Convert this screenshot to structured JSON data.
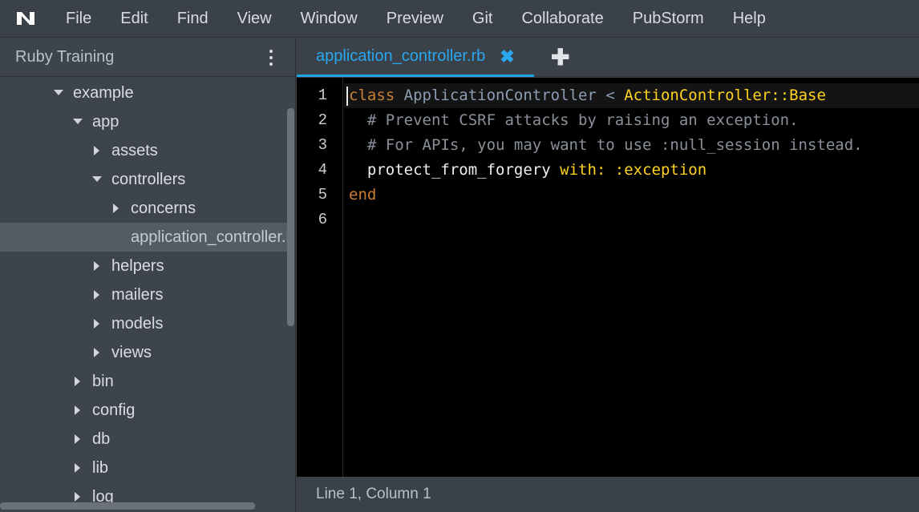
{
  "menu": {
    "logo_icon": "nitrous-n-icon",
    "items": [
      "File",
      "Edit",
      "Find",
      "View",
      "Window",
      "Preview",
      "Git",
      "Collaborate",
      "PubStorm",
      "Help"
    ]
  },
  "sidebar": {
    "project_title": "Ruby Training",
    "tree": [
      {
        "label": "example",
        "expanded": true
      },
      {
        "label": "app",
        "expanded": true
      },
      {
        "label": "assets",
        "expanded": false
      },
      {
        "label": "controllers",
        "expanded": true
      },
      {
        "label": "concerns",
        "expanded": false
      },
      {
        "label": "application_controller.rb",
        "selected": true
      },
      {
        "label": "helpers",
        "expanded": false
      },
      {
        "label": "mailers",
        "expanded": false
      },
      {
        "label": "models",
        "expanded": false
      },
      {
        "label": "views",
        "expanded": false
      },
      {
        "label": "bin",
        "expanded": false
      },
      {
        "label": "config",
        "expanded": false
      },
      {
        "label": "db",
        "expanded": false
      },
      {
        "label": "lib",
        "expanded": false
      },
      {
        "label": "log",
        "expanded": false
      }
    ]
  },
  "tabs": {
    "active_tab": {
      "label": "application_controller.rb",
      "close_glyph": "✖"
    },
    "add_glyph": "✚"
  },
  "editor": {
    "line_numbers": [
      "1",
      "2",
      "3",
      "4",
      "5",
      "6"
    ],
    "lines": {
      "l1": {
        "kw": "class",
        "cls": "ApplicationController",
        "op": "<",
        "const": "ActionController::Base"
      },
      "l2": {
        "cmt": "# Prevent CSRF attacks by raising an exception."
      },
      "l3": {
        "cmt": "# For APIs, you may want to use :null_session instead."
      },
      "l4": {
        "ident": "protect_from_forgery",
        "key": "with:",
        "sym": ":exception"
      },
      "l5": {
        "kw": "end"
      },
      "l6": {}
    }
  },
  "status": {
    "position": "Line 1, Column 1"
  },
  "colors": {
    "accent": "#29a8f0",
    "keyword": "#c87f35",
    "constant": "#ffd21f",
    "comment": "#8a9099",
    "classname": "#8c9db4"
  }
}
